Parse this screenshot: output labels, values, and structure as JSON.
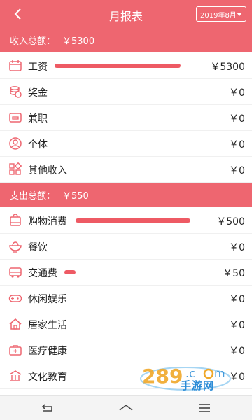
{
  "header": {
    "title": "月报表",
    "month_select": "2019年8月"
  },
  "income": {
    "label": "收入总额：",
    "total": "￥5300",
    "items": [
      {
        "label": "工资",
        "value": "￥5300",
        "icon": "calendar-icon",
        "share": 1.0
      },
      {
        "label": "奖金",
        "value": "￥0",
        "icon": "coins-icon",
        "share": 0
      },
      {
        "label": "兼职",
        "value": "￥0",
        "icon": "wallet-icon",
        "share": 0
      },
      {
        "label": "个体",
        "value": "￥0",
        "icon": "person-icon",
        "share": 0
      },
      {
        "label": "其他收入",
        "value": "￥0",
        "icon": "grid-icon",
        "share": 0
      }
    ]
  },
  "expense": {
    "label": "支出总额：",
    "total": "￥550",
    "items": [
      {
        "label": "购物消费",
        "value": "￥500",
        "icon": "shopping-bag-icon",
        "share": 0.91
      },
      {
        "label": "餐饮",
        "value": "￥0",
        "icon": "bowl-icon",
        "share": 0
      },
      {
        "label": "交通费",
        "value": "￥50",
        "icon": "bus-icon",
        "share": 0.09
      },
      {
        "label": "休闲娱乐",
        "value": "￥0",
        "icon": "gamepad-icon",
        "share": 0
      },
      {
        "label": "居家生活",
        "value": "￥0",
        "icon": "house-icon",
        "share": 0
      },
      {
        "label": "医疗健康",
        "value": "￥0",
        "icon": "medical-kit-icon",
        "share": 0
      },
      {
        "label": "文化教育",
        "value": "￥0",
        "icon": "school-icon",
        "share": 0
      }
    ]
  },
  "watermark": {
    "text": "289.com",
    "subtext": "手游网"
  },
  "colors": {
    "accent": "#ee6670",
    "bar": "#ee5a64",
    "icon": "#ee6670"
  }
}
